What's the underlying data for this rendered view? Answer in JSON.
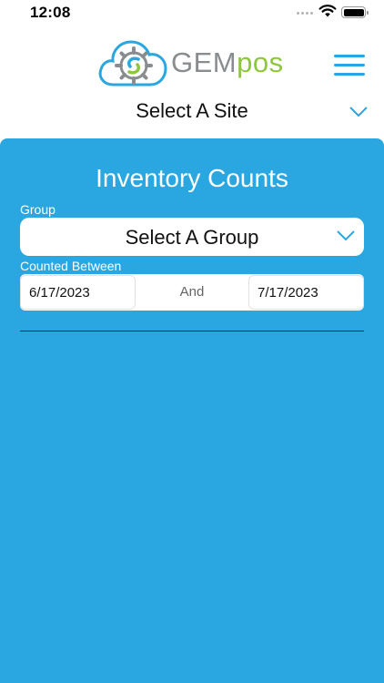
{
  "status_bar": {
    "time": "12:08",
    "icons": [
      "signal-dots-icon",
      "wifi-icon",
      "battery-icon"
    ]
  },
  "header": {
    "logo": {
      "brand_primary": "GEM",
      "brand_secondary": "pos"
    },
    "menu_icon": "hamburger-menu-icon",
    "site_select": {
      "value": "Select A Site",
      "icon": "chevron-down-icon"
    }
  },
  "main": {
    "title": "Inventory Counts",
    "group": {
      "label": "Group",
      "value": "Select A Group",
      "icon": "chevron-down-icon"
    },
    "counted_between": {
      "label": "Counted Between",
      "from": "6/17/2023",
      "and_label": "And",
      "to": "7/17/2023"
    }
  },
  "colors": {
    "accent": "#2aa7e0",
    "brand_gray": "#8a8d90",
    "brand_green": "#8dc63f",
    "panel_bg": "#2aa7e0",
    "text": "#111111"
  }
}
